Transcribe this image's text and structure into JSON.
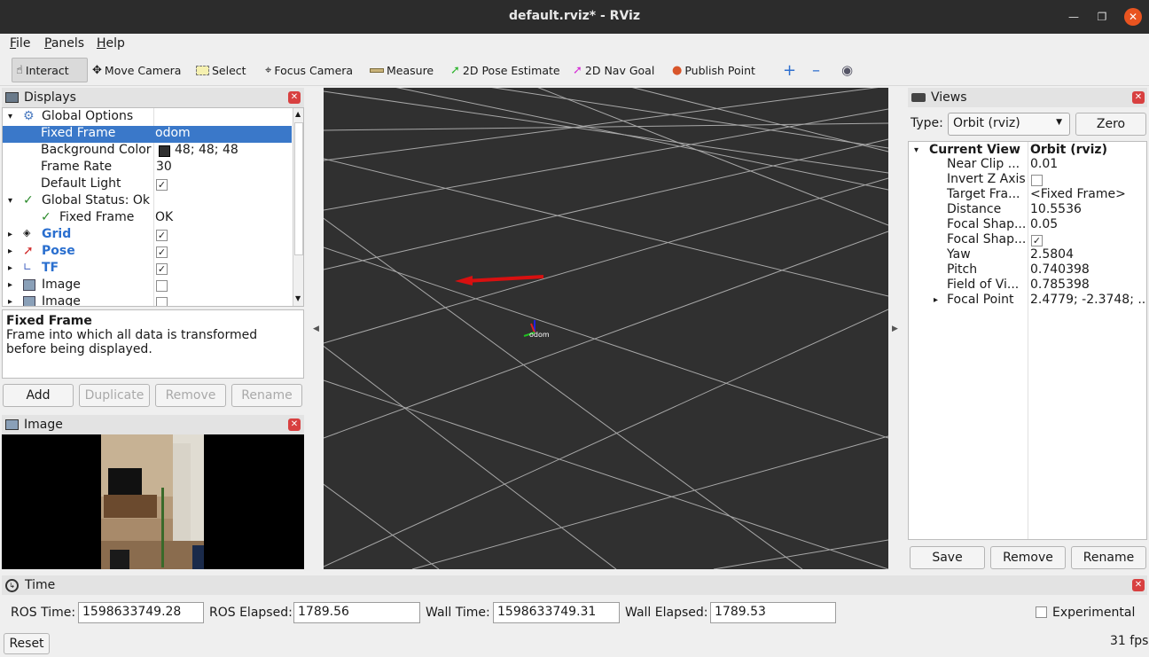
{
  "window": {
    "title": "default.rviz* - RViz"
  },
  "menubar": {
    "file": "File",
    "panels": "Panels",
    "help": "Help"
  },
  "toolbar": {
    "interact": "Interact",
    "move_camera": "Move Camera",
    "select": "Select",
    "focus_camera": "Focus Camera",
    "measure": "Measure",
    "pose_estimate": "2D Pose Estimate",
    "nav_goal": "2D Nav Goal",
    "publish_point": "Publish Point"
  },
  "displays": {
    "title": "Displays",
    "global_options": "Global Options",
    "fixed_frame_label": "Fixed Frame",
    "fixed_frame_value": "odom",
    "bg_color_label": "Background Color",
    "bg_color_value": "48; 48; 48",
    "frame_rate_label": "Frame Rate",
    "frame_rate_value": "30",
    "default_light_label": "Default Light",
    "global_status": "Global Status: Ok",
    "status_fixed_frame": "Fixed Frame",
    "status_fixed_frame_value": "OK",
    "grid": "Grid",
    "pose": "Pose",
    "tf": "TF",
    "image1": "Image",
    "image2": "Image",
    "desc_title": "Fixed Frame",
    "desc_text": "Frame into which all data is transformed before being displayed.",
    "add": "Add",
    "duplicate": "Duplicate",
    "remove": "Remove",
    "rename": "Rename"
  },
  "image_panel": {
    "title": "Image"
  },
  "viewport": {
    "frame_label": "odom",
    "bg_color": "#303030"
  },
  "views": {
    "title": "Views",
    "type_label": "Type:",
    "type_value": "Orbit (rviz)",
    "zero": "Zero",
    "current_view": "Current View",
    "current_view_value": "Orbit (rviz)",
    "props": [
      {
        "k": "Near Clip ...",
        "v": "0.01"
      },
      {
        "k": "Invert Z Axis",
        "v": ""
      },
      {
        "k": "Target Fra...",
        "v": "<Fixed Frame>"
      },
      {
        "k": "Distance",
        "v": "10.5536"
      },
      {
        "k": "Focal Shap...",
        "v": "0.05"
      },
      {
        "k": "Focal Shap...",
        "v": ""
      },
      {
        "k": "Yaw",
        "v": "2.5804"
      },
      {
        "k": "Pitch",
        "v": "0.740398"
      },
      {
        "k": "Field of Vi...",
        "v": "0.785398"
      },
      {
        "k": "Focal Point",
        "v": "2.4779; -2.3748; ..."
      }
    ],
    "save": "Save",
    "remove": "Remove",
    "rename": "Rename"
  },
  "time": {
    "title": "Time",
    "ros_time_label": "ROS Time:",
    "ros_time": "1598633749.28",
    "ros_elapsed_label": "ROS Elapsed:",
    "ros_elapsed": "1789.56",
    "wall_time_label": "Wall Time:",
    "wall_time": "1598633749.31",
    "wall_elapsed_label": "Wall Elapsed:",
    "wall_elapsed": "1789.53",
    "experimental": "Experimental",
    "reset": "Reset",
    "fps": "31 fps"
  }
}
